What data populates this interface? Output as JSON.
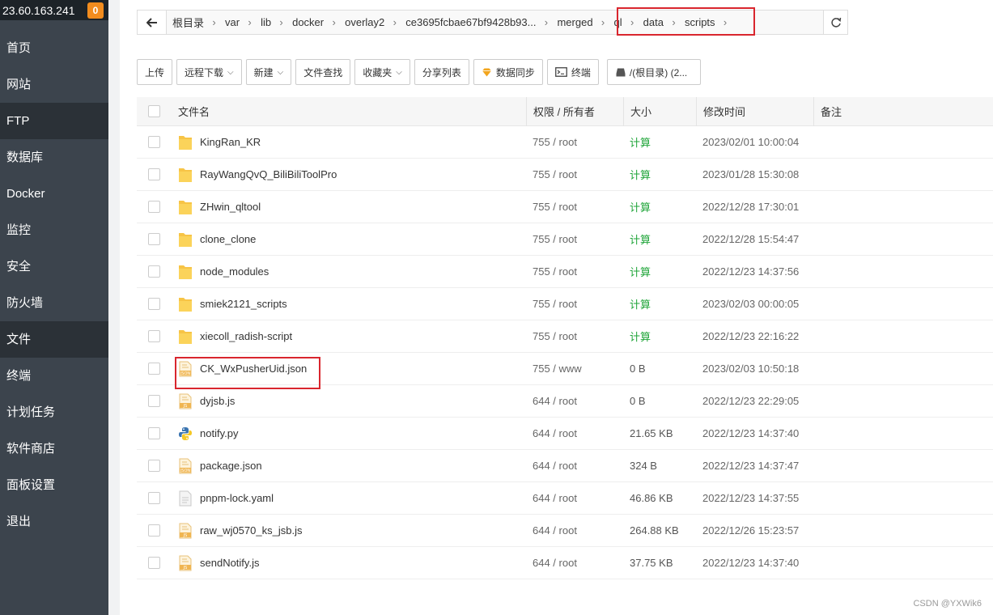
{
  "sidebar": {
    "ip": "23.60.163.241",
    "badge": "0",
    "items": [
      {
        "label": "首页"
      },
      {
        "label": "网站"
      },
      {
        "label": "FTP"
      },
      {
        "label": "数据库"
      },
      {
        "label": "Docker"
      },
      {
        "label": "监控"
      },
      {
        "label": "安全"
      },
      {
        "label": "防火墙"
      },
      {
        "label": "文件"
      },
      {
        "label": "终端"
      },
      {
        "label": "计划任务"
      },
      {
        "label": "软件商店"
      },
      {
        "label": "面板设置"
      },
      {
        "label": "退出"
      }
    ]
  },
  "breadcrumb": [
    "根目录",
    "var",
    "lib",
    "docker",
    "overlay2",
    "ce3695fcbae67bf9428b93...",
    "merged",
    "ql",
    "data",
    "scripts"
  ],
  "toolbar": {
    "upload": "上传",
    "remote_download": "远程下载",
    "new": "新建",
    "file_search": "文件查找",
    "favorites": "收藏夹",
    "share_list": "分享列表",
    "data_sync": "数据同步",
    "terminal": "终端",
    "disk": "/(根目录) (2..."
  },
  "table": {
    "headers": {
      "name": "文件名",
      "perm": "权限 / 所有者",
      "size": "大小",
      "mtime": "修改时间",
      "note": "备注"
    },
    "rows": [
      {
        "icon": "folder-icon",
        "name": "KingRan_KR",
        "perm": "755 / root",
        "size": "计算",
        "mtime": "2023/02/01 10:00:04"
      },
      {
        "icon": "folder-icon",
        "name": "RayWangQvQ_BiliBiliToolPro",
        "perm": "755 / root",
        "size": "计算",
        "mtime": "2023/01/28 15:30:08"
      },
      {
        "icon": "folder-icon",
        "name": "ZHwin_qltool",
        "perm": "755 / root",
        "size": "计算",
        "mtime": "2022/12/28 17:30:01"
      },
      {
        "icon": "folder-icon",
        "name": "clone_clone",
        "perm": "755 / root",
        "size": "计算",
        "mtime": "2022/12/28 15:54:47"
      },
      {
        "icon": "folder-icon",
        "name": "node_modules",
        "perm": "755 / root",
        "size": "计算",
        "mtime": "2022/12/23 14:37:56"
      },
      {
        "icon": "folder-icon",
        "name": "smiek2121_scripts",
        "perm": "755 / root",
        "size": "计算",
        "mtime": "2023/02/03 00:00:05"
      },
      {
        "icon": "folder-icon",
        "name": "xiecoll_radish-script",
        "perm": "755 / root",
        "size": "计算",
        "mtime": "2022/12/23 22:16:22"
      },
      {
        "icon": "json-file-icon",
        "name": "CK_WxPusherUid.json",
        "perm": "755 / www",
        "size": "0 B",
        "mtime": "2023/02/03 10:50:18"
      },
      {
        "icon": "js-file-icon",
        "name": "dyjsb.js",
        "perm": "644 / root",
        "size": "0 B",
        "mtime": "2022/12/23 22:29:05"
      },
      {
        "icon": "python-file-icon",
        "name": "notify.py",
        "perm": "644 / root",
        "size": "21.65 KB",
        "mtime": "2022/12/23 14:37:40"
      },
      {
        "icon": "json-file-icon",
        "name": "package.json",
        "perm": "644 / root",
        "size": "324 B",
        "mtime": "2022/12/23 14:37:47"
      },
      {
        "icon": "text-file-icon",
        "name": "pnpm-lock.yaml",
        "perm": "644 / root",
        "size": "46.86 KB",
        "mtime": "2022/12/23 14:37:55"
      },
      {
        "icon": "js-file-icon",
        "name": "raw_wj0570_ks_jsb.js",
        "perm": "644 / root",
        "size": "264.88 KB",
        "mtime": "2022/12/26 15:23:57"
      },
      {
        "icon": "js-file-icon",
        "name": "sendNotify.js",
        "perm": "644 / root",
        "size": "37.75 KB",
        "mtime": "2022/12/23 14:37:40"
      }
    ]
  },
  "watermark": "CSDN @YXWik6",
  "colors": {
    "sidebar": "#3c444d",
    "accent_green": "#20a53a",
    "highlight_red": "#d9262e",
    "badge": "#f28c1e"
  }
}
